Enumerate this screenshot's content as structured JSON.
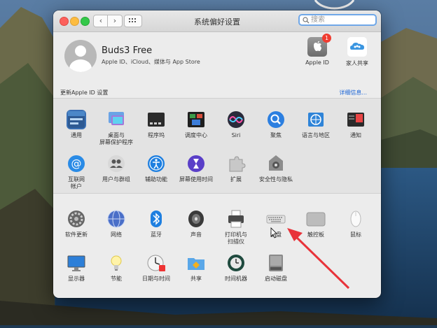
{
  "window": {
    "title": "系统偏好设置",
    "search_placeholder": "搜索"
  },
  "user": {
    "name": "Buds3 Free",
    "subtitle": "Apple ID、iCloud、媒体与 App Store"
  },
  "top_icons": {
    "apple_id_label": "Apple ID",
    "apple_id_badge": "1",
    "family_label": "家人共享"
  },
  "update": {
    "left_text": "更新Apple ID 设置",
    "right_link": "详细信息..."
  },
  "row1": [
    {
      "label": "通用",
      "icon": "general-icon"
    },
    {
      "label": "桌面与\n屏幕保护程序",
      "icon": "desktop-screensaver-icon"
    },
    {
      "label": "程序坞",
      "icon": "dock-icon"
    },
    {
      "label": "调度中心",
      "icon": "mission-control-icon"
    },
    {
      "label": "Siri",
      "icon": "siri-icon"
    },
    {
      "label": "聚焦",
      "icon": "spotlight-icon"
    },
    {
      "label": "语言与地区",
      "icon": "language-region-icon"
    },
    {
      "label": "通知",
      "icon": "notifications-icon"
    }
  ],
  "row2": [
    {
      "label": "互联网\n帐户",
      "icon": "internet-accounts-icon"
    },
    {
      "label": "用户与群组",
      "icon": "users-groups-icon"
    },
    {
      "label": "辅助功能",
      "icon": "accessibility-icon"
    },
    {
      "label": "屏幕使用时间",
      "icon": "screen-time-icon"
    },
    {
      "label": "扩展",
      "icon": "extensions-icon"
    },
    {
      "label": "安全性与隐私",
      "icon": "security-privacy-icon"
    }
  ],
  "row3": [
    {
      "label": "软件更新",
      "icon": "software-update-icon"
    },
    {
      "label": "网络",
      "icon": "network-icon"
    },
    {
      "label": "蓝牙",
      "icon": "bluetooth-icon"
    },
    {
      "label": "声音",
      "icon": "sound-icon"
    },
    {
      "label": "打印机与\n扫描仪",
      "icon": "printers-scanners-icon"
    },
    {
      "label": "键盘",
      "icon": "keyboard-icon"
    },
    {
      "label": "触控板",
      "icon": "trackpad-icon"
    },
    {
      "label": "鼠标",
      "icon": "mouse-icon"
    }
  ],
  "row4": [
    {
      "label": "显示器",
      "icon": "displays-icon"
    },
    {
      "label": "节能",
      "icon": "energy-saver-icon"
    },
    {
      "label": "日期与时间",
      "icon": "date-time-icon"
    },
    {
      "label": "共享",
      "icon": "sharing-icon"
    },
    {
      "label": "时间机器",
      "icon": "time-machine-icon"
    },
    {
      "label": "启动磁盘",
      "icon": "startup-disk-icon"
    }
  ],
  "colors": {
    "window_bg": "#ececec",
    "accent": "#1a64d6",
    "annotation_arrow": "#e8333a"
  }
}
